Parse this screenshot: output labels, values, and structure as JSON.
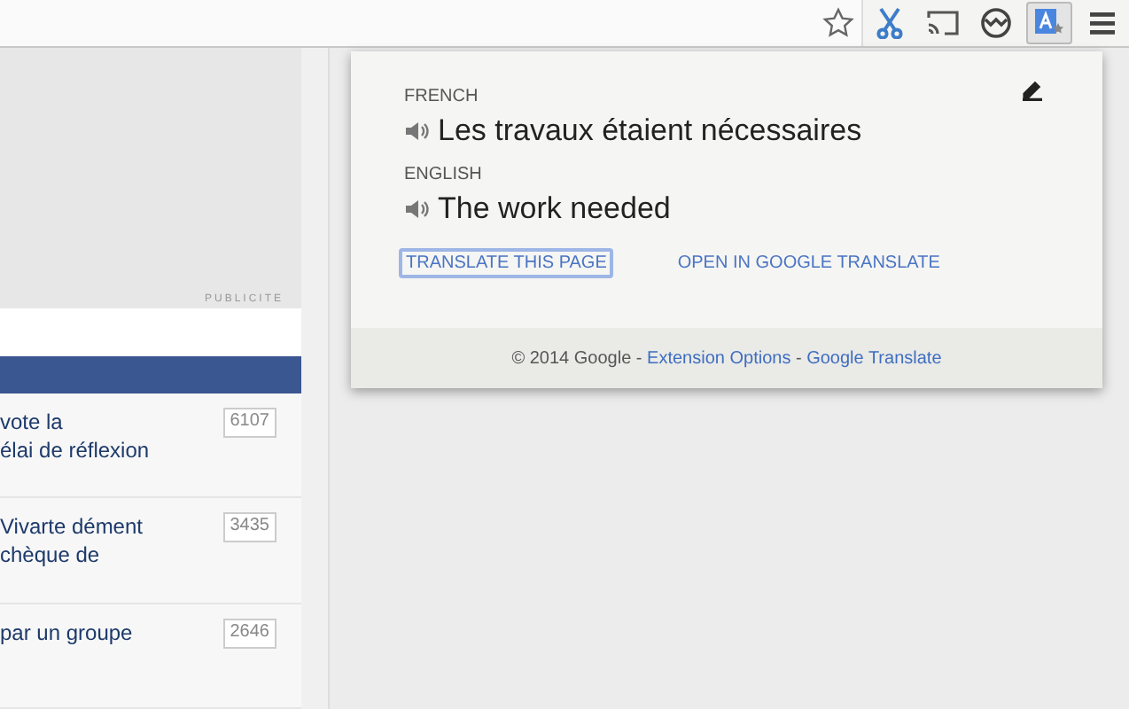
{
  "toolbar": {
    "icons": [
      {
        "kind": "scissors"
      },
      {
        "kind": "cast"
      },
      {
        "kind": "sync"
      },
      {
        "kind": "translate",
        "selected": true
      },
      {
        "kind": "menu"
      }
    ]
  },
  "ad": {
    "label": "PUBLICITE"
  },
  "articles": [
    {
      "lines": [
        "vote la",
        "élai de réflexion"
      ],
      "count": "6107"
    },
    {
      "lines": [
        "Vivarte dément",
        "chèque de"
      ],
      "count": "3435"
    },
    {
      "lines": [
        "par un groupe"
      ],
      "count": "2646"
    }
  ],
  "popup": {
    "source": {
      "language": "FRENCH",
      "text": "Les travaux étaient nécessaires"
    },
    "target": {
      "language": "ENGLISH",
      "text": "The work needed"
    },
    "actions": [
      {
        "label": "TRANSLATE THIS PAGE",
        "selected": true
      },
      {
        "label": "OPEN IN GOOGLE TRANSLATE",
        "selected": false
      }
    ],
    "footer": {
      "text": "© 2014 Google - ",
      "links": [
        "Extension Options",
        "Google Translate"
      ],
      "separator": " - "
    }
  }
}
